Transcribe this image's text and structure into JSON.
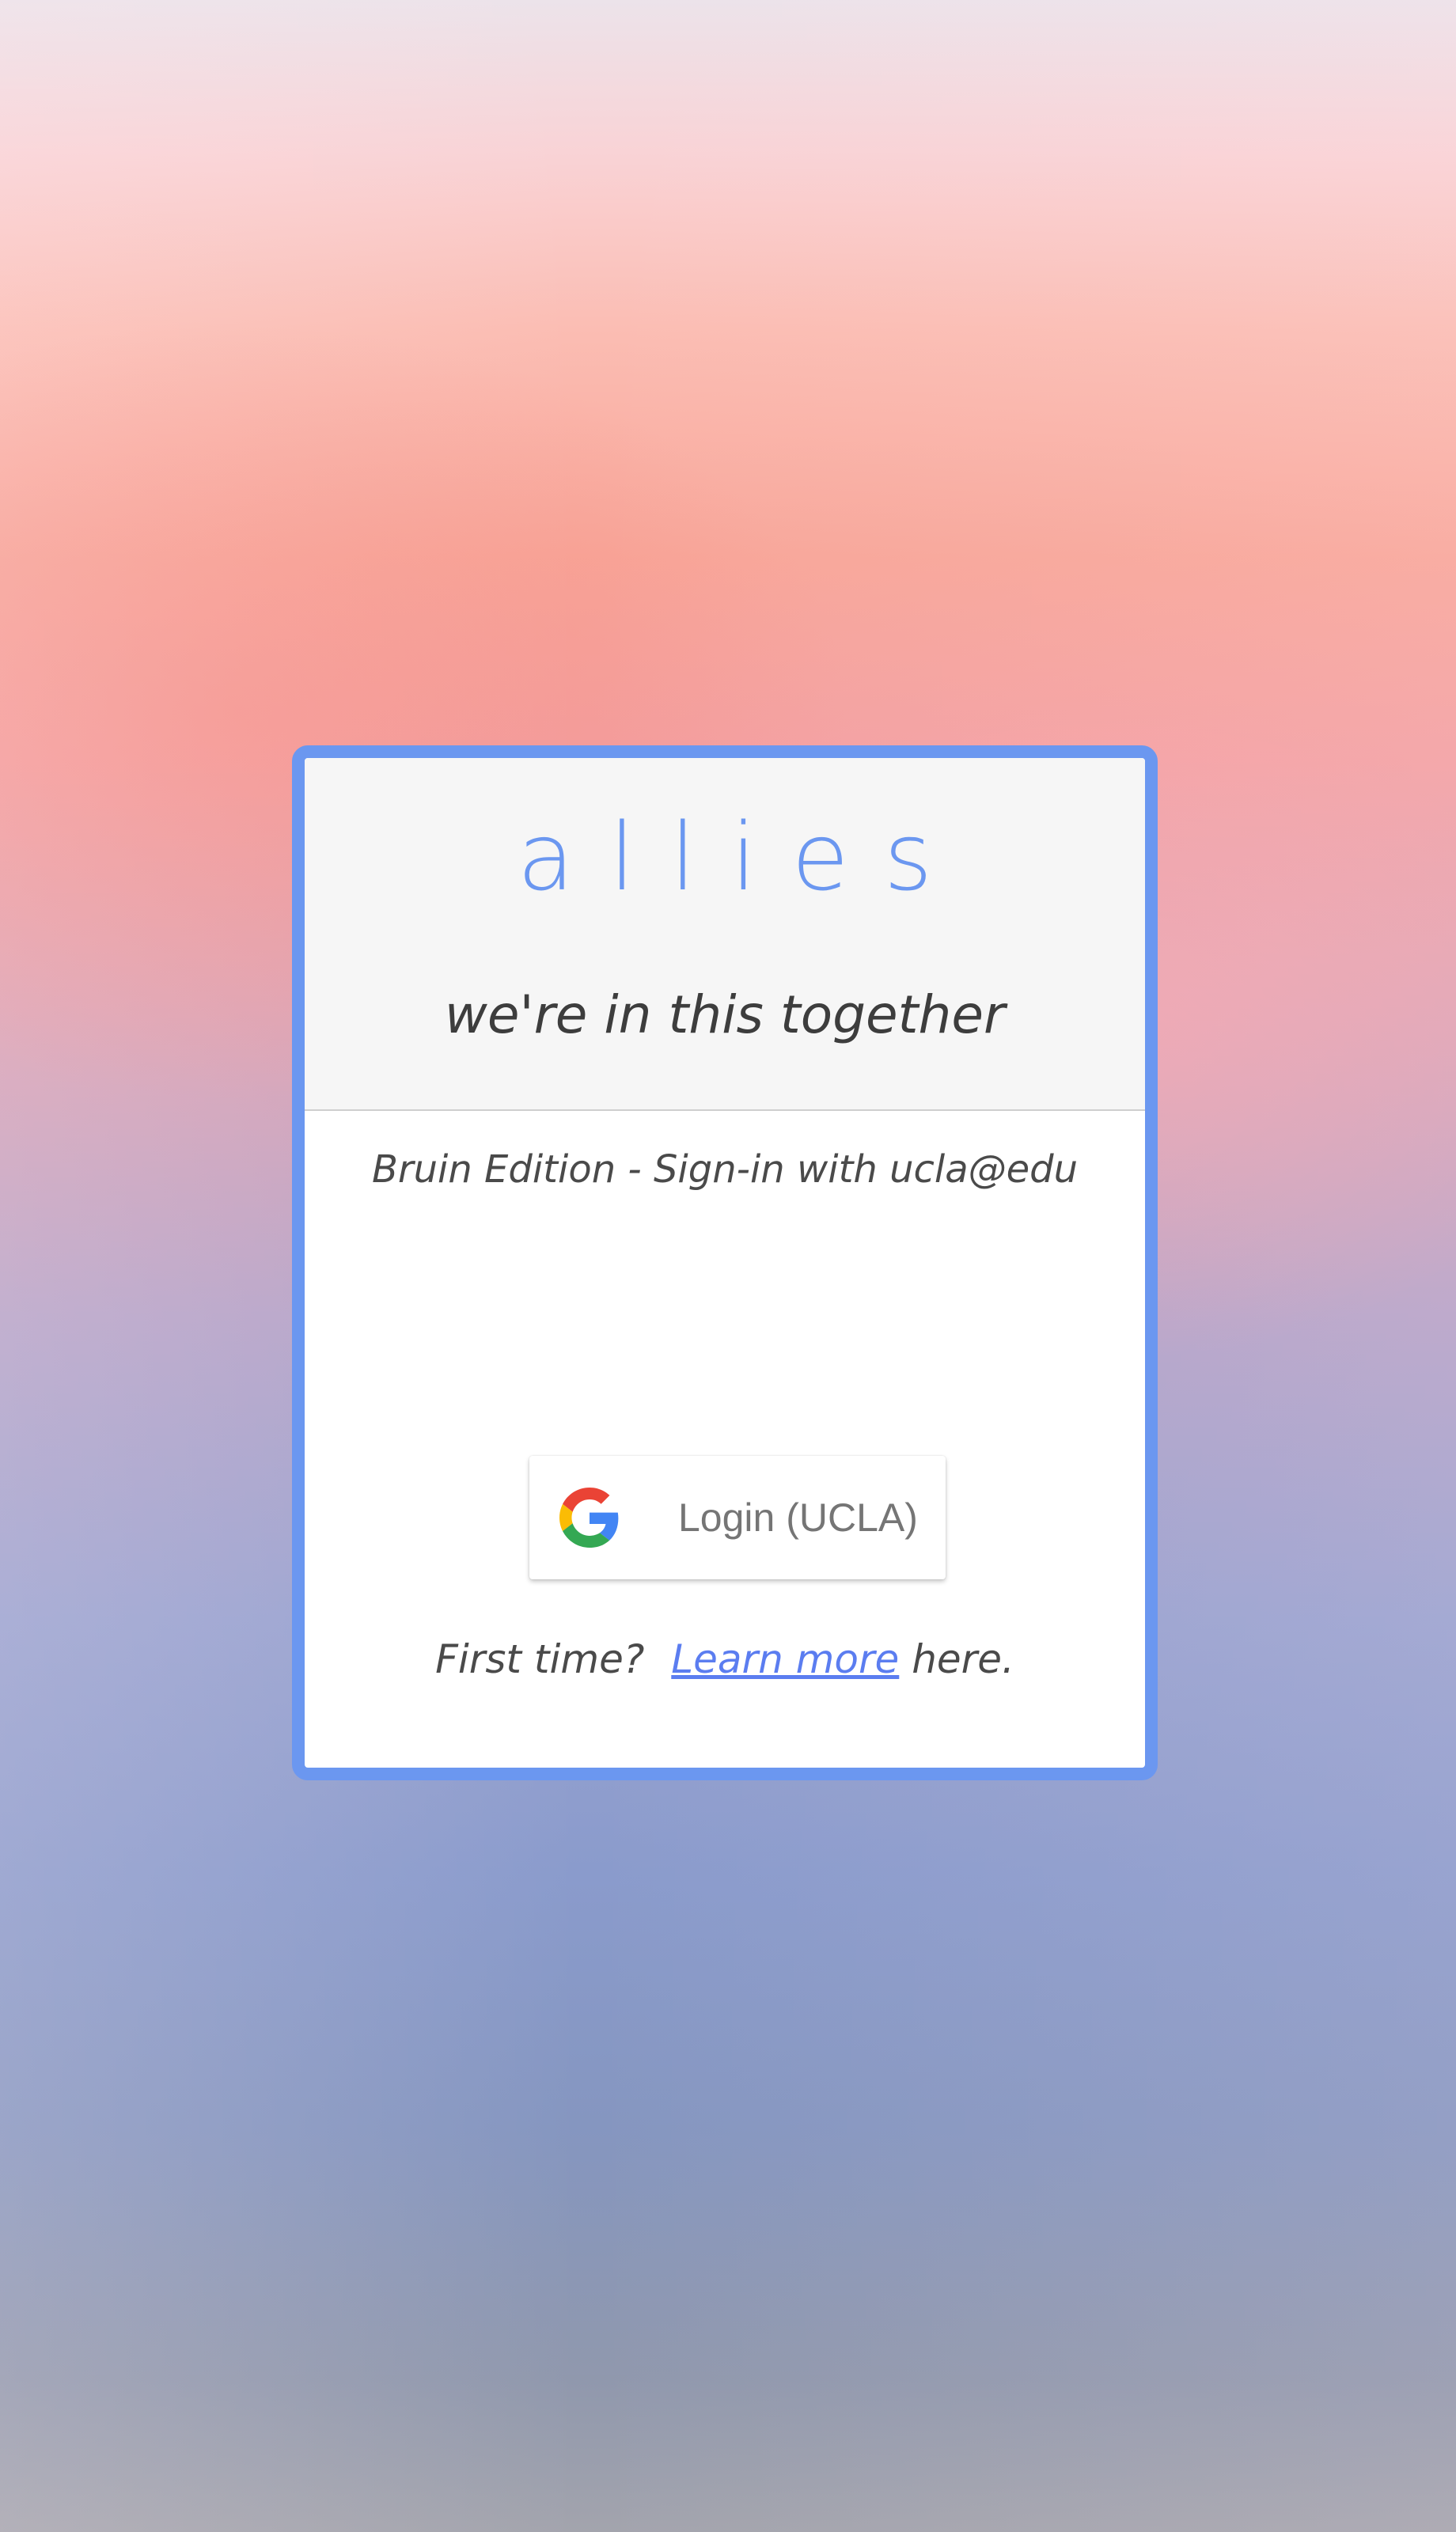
{
  "app": {
    "logo_text": "allies",
    "tagline": "we're in this together"
  },
  "auth": {
    "edition_text": "Bruin Edition - Sign-in with ucla@edu",
    "login_button_label": "Login (UCLA)",
    "login_icon": "google-g-icon",
    "first_time_prefix": "First time?",
    "learn_more_link": "Learn more",
    "first_time_suffix": "here."
  },
  "colors": {
    "accent": "#6b97f0",
    "link": "#5b7df0",
    "card_header_bg": "#f6f6f6",
    "text": "#4a4a4a"
  }
}
